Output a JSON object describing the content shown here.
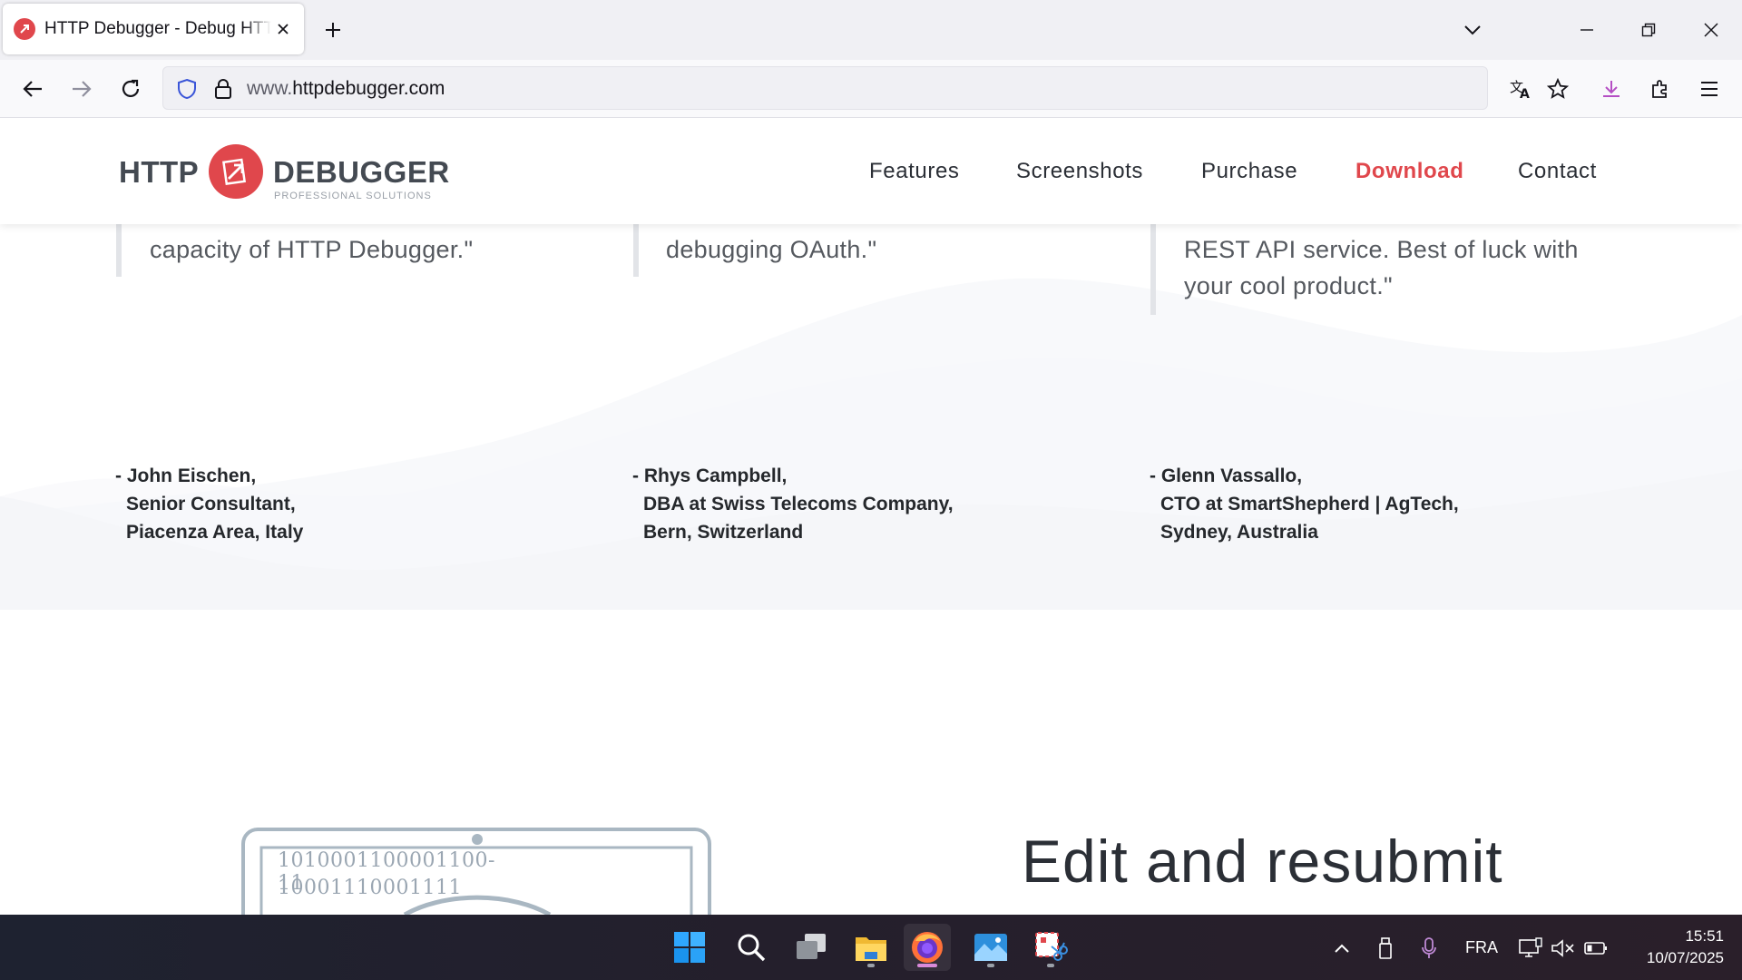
{
  "browser": {
    "tab_title": "HTTP Debugger - Debug HTTP API",
    "url_prefix": "www.",
    "url_domain": "httpdebugger.com"
  },
  "site": {
    "logo_left": "HTTP",
    "logo_right": "DEBUGGER",
    "logo_tagline": "PROFESSIONAL SOLUTIONS",
    "menu": [
      "Features",
      "Screenshots",
      "Purchase",
      "Download",
      "Contact"
    ],
    "accent_color": "#e0474c"
  },
  "testimonials": [
    {
      "quote": "capacity of HTTP Debugger.\"",
      "author_name": "- John Eischen,",
      "author_role": "Senior Consultant,",
      "author_location": "Piacenza Area, Italy"
    },
    {
      "quote": "debugging OAuth.\"",
      "author_name": "- Rhys Campbell,",
      "author_role": "DBA at Swiss Telecoms Company,",
      "author_location": "Bern, Switzerland"
    },
    {
      "quote_line1": "REST API service. Best of luck with",
      "quote_line2": "your cool product.\"",
      "author_name": "- Glenn Vassallo,",
      "author_role": "CTO at SmartShepherd | AgTech,",
      "author_location": "Sydney, Australia"
    }
  ],
  "feature": {
    "heading": "Edit and resubmit",
    "binary_line1": "1010001100001100­11",
    "binary_line2": "10001110001111"
  },
  "taskbar": {
    "language": "FRA",
    "time": "15:51",
    "date": "10/07/2025"
  }
}
